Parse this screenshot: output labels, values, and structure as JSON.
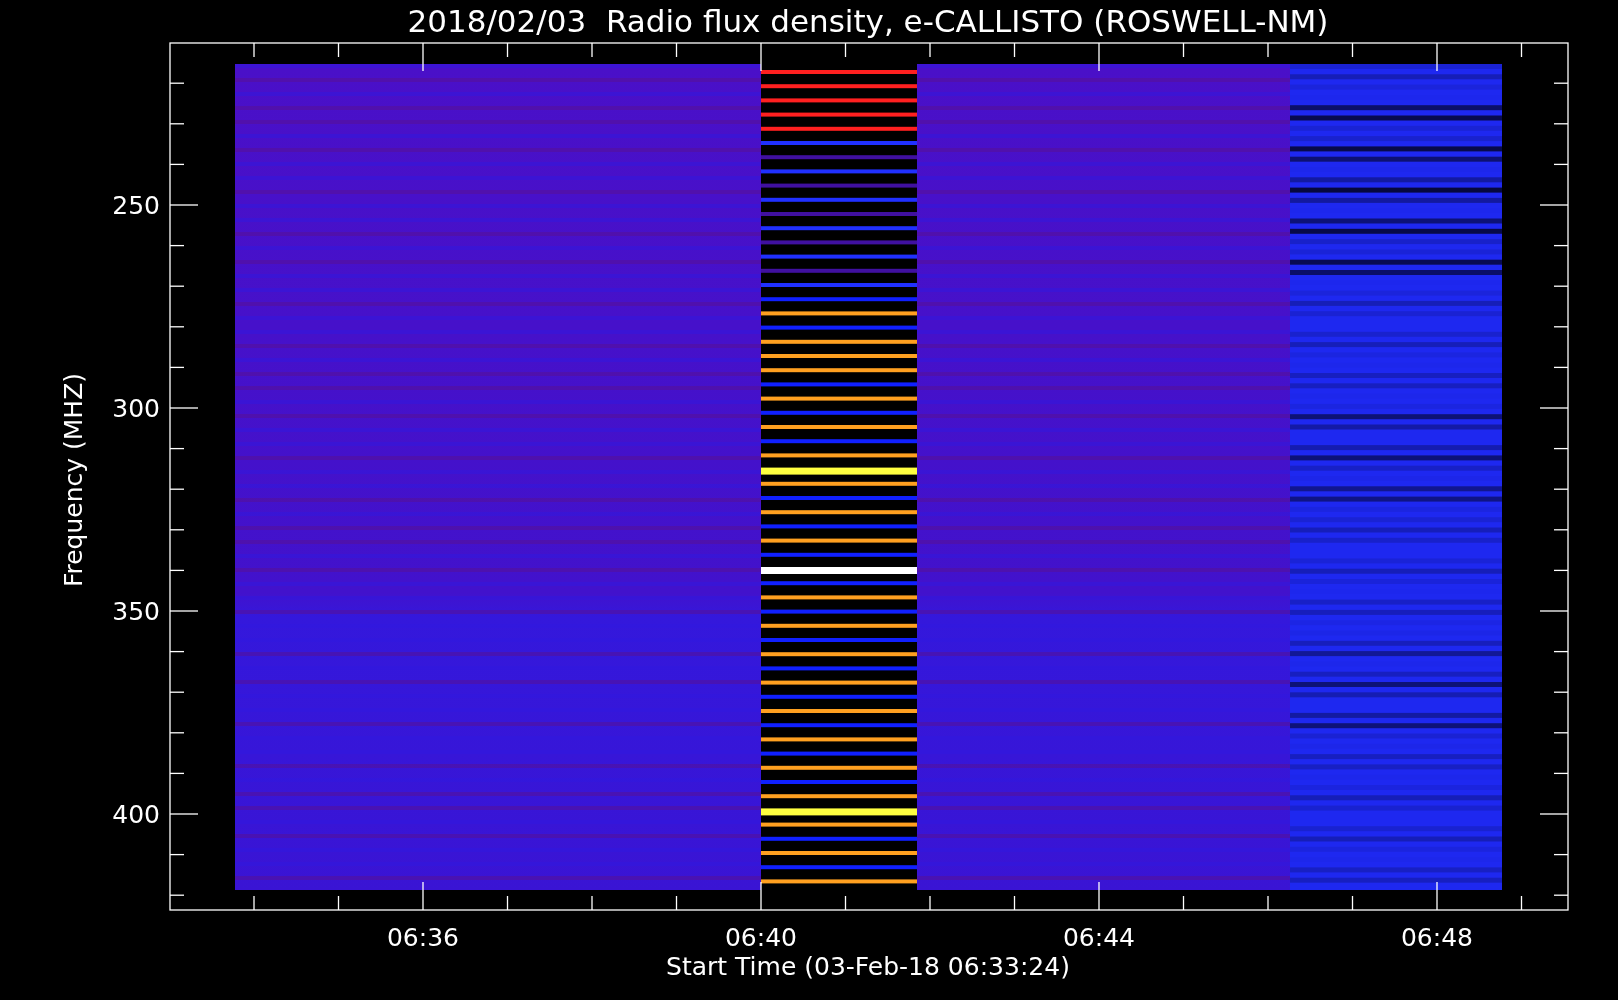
{
  "title": "2018/02/03  Radio flux density, e-CALLISTO (ROSWELL-NM)",
  "y_axis": {
    "label": "Frequency (MHZ)",
    "ticks": [
      "250",
      "300",
      "350",
      "400"
    ]
  },
  "x_axis": {
    "label": "Start Time (03-Feb-18 06:33:24)",
    "ticks": [
      "06:36",
      "06:40",
      "06:44",
      "06:48"
    ]
  }
}
